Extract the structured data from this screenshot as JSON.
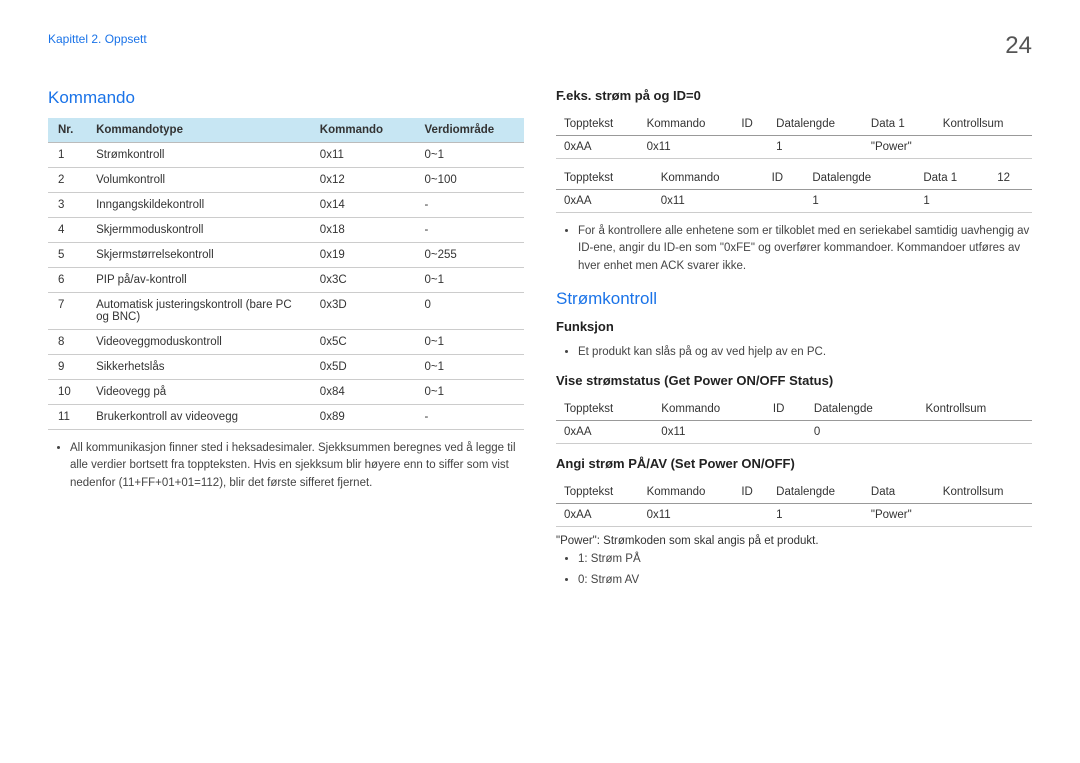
{
  "header": {
    "breadcrumb": "Kapittel 2. Oppsett",
    "page_number": "24"
  },
  "left": {
    "title": "Kommando",
    "table": {
      "headers": {
        "nr": "Nr.",
        "type": "Kommandotype",
        "cmd": "Kommando",
        "range": "Verdiområde"
      },
      "rows": [
        {
          "nr": "1",
          "type": "Strømkontroll",
          "cmd": "0x11",
          "range": "0~1"
        },
        {
          "nr": "2",
          "type": "Volumkontroll",
          "cmd": "0x12",
          "range": "0~100"
        },
        {
          "nr": "3",
          "type": "Inngangskildekontroll",
          "cmd": "0x14",
          "range": "-"
        },
        {
          "nr": "4",
          "type": "Skjermmoduskontroll",
          "cmd": "0x18",
          "range": "-"
        },
        {
          "nr": "5",
          "type": "Skjermstørrelsekontroll",
          "cmd": "0x19",
          "range": "0~255"
        },
        {
          "nr": "6",
          "type": "PIP på/av-kontroll",
          "cmd": "0x3C",
          "range": "0~1"
        },
        {
          "nr": "7",
          "type": "Automatisk justeringskontroll (bare PC og BNC)",
          "cmd": "0x3D",
          "range": "0"
        },
        {
          "nr": "8",
          "type": "Videoveggmoduskontroll",
          "cmd": "0x5C",
          "range": "0~1"
        },
        {
          "nr": "9",
          "type": "Sikkerhetslås",
          "cmd": "0x5D",
          "range": "0~1"
        },
        {
          "nr": "10",
          "type": "Videovegg på",
          "cmd": "0x84",
          "range": "0~1"
        },
        {
          "nr": "11",
          "type": "Brukerkontroll av videovegg",
          "cmd": "0x89",
          "range": "-"
        }
      ]
    },
    "note": "All kommunikasjon finner sted i heksadesimaler. Sjekksummen beregnes ved å legge til alle verdier bortsett fra toppteksten. Hvis en sjekksum blir høyere enn to siffer som vist nedenfor (11+FF+01+01=112), blir det første sifferet fjernet."
  },
  "right": {
    "ex": {
      "title": "F.eks. strøm på og ID=0",
      "t1": {
        "h": {
          "c0": "Topptekst",
          "c1": "Kommando",
          "c2": "ID",
          "c3": "Datalengde",
          "c4": "Data 1",
          "c5": "Kontrollsum"
        },
        "r": {
          "c0": "0xAA",
          "c1": "0x11",
          "c2": "",
          "c3": "1",
          "c4": "\"Power\"",
          "c5": ""
        }
      },
      "t2": {
        "h": {
          "c0": "Topptekst",
          "c1": "Kommando",
          "c2": "ID",
          "c3": "Datalengde",
          "c4": "Data 1",
          "c5": "12"
        },
        "r": {
          "c0": "0xAA",
          "c1": "0x11",
          "c2": "",
          "c3": "1",
          "c4": "1",
          "c5": ""
        }
      },
      "note": "For å kontrollere alle enhetene som er tilkoblet med en seriekabel samtidig uavhengig av ID-ene, angir du ID-en som \"0xFE\" og overfører kommandoer. Kommandoer utføres av hver enhet men ACK svarer ikke."
    },
    "power": {
      "title": "Strømkontroll",
      "func_label": "Funksjon",
      "func_note": "Et produkt kan slås på og av ved hjelp av en PC.",
      "view_label": "Vise strømstatus (Get Power ON/OFF Status)",
      "view_t": {
        "h": {
          "c0": "Topptekst",
          "c1": "Kommando",
          "c2": "ID",
          "c3": "Datalengde",
          "c4": "Kontrollsum"
        },
        "r": {
          "c0": "0xAA",
          "c1": "0x11",
          "c2": "",
          "c3": "0",
          "c4": ""
        }
      },
      "set_label": "Angi strøm PÅ/AV (Set Power ON/OFF)",
      "set_t": {
        "h": {
          "c0": "Topptekst",
          "c1": "Kommando",
          "c2": "ID",
          "c3": "Datalengde",
          "c4": "Data",
          "c5": "Kontrollsum"
        },
        "r": {
          "c0": "0xAA",
          "c1": "0x11",
          "c2": "",
          "c3": "1",
          "c4": "\"Power\"",
          "c5": ""
        }
      },
      "power_desc": "\"Power\": Strømkoden som skal angis på et produkt.",
      "on": "1: Strøm PÅ",
      "off": "0: Strøm AV"
    }
  }
}
